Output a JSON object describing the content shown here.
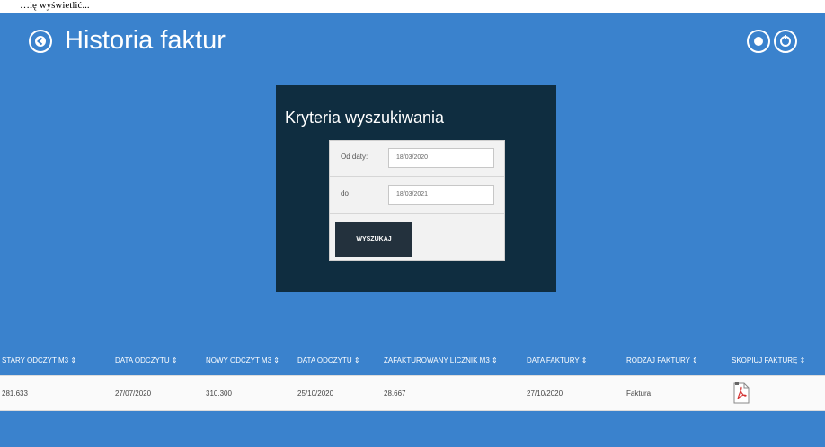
{
  "caption": "…ię wyświetlić...",
  "header": {
    "title": "Historia faktur"
  },
  "search": {
    "title": "Kryteria wyszukiwania",
    "from_label": "Od daty:",
    "from_value": "18/03/2020",
    "to_label": "do",
    "to_value": "18/03/2021",
    "button_label": "WYSZUKAJ"
  },
  "table": {
    "columns": [
      "STARY ODCZYT M3 ⇕",
      "DATA ODCZYTU ⇕",
      "NOWY ODCZYT M3 ⇕",
      "DATA ODCZYTU ⇕",
      "ZAFAKTUROWANY LICZNIK M3 ⇕",
      "DATA FAKTURY ⇕",
      "RODZAJ FAKTURY ⇕",
      "SKOPIUJ FAKTURĘ ⇕"
    ],
    "rows": [
      {
        "old_reading": "281.633",
        "reading_date_1": "27/07/2020",
        "new_reading": "310.300",
        "reading_date_2": "25/10/2020",
        "billed": "28.667",
        "invoice_date": "27/10/2020",
        "invoice_type": "Faktura",
        "copy_icon": "pdf-icon"
      }
    ]
  },
  "colors": {
    "background": "#3a82cd",
    "search_panel": "#0f2d40",
    "button": "#23313d"
  }
}
